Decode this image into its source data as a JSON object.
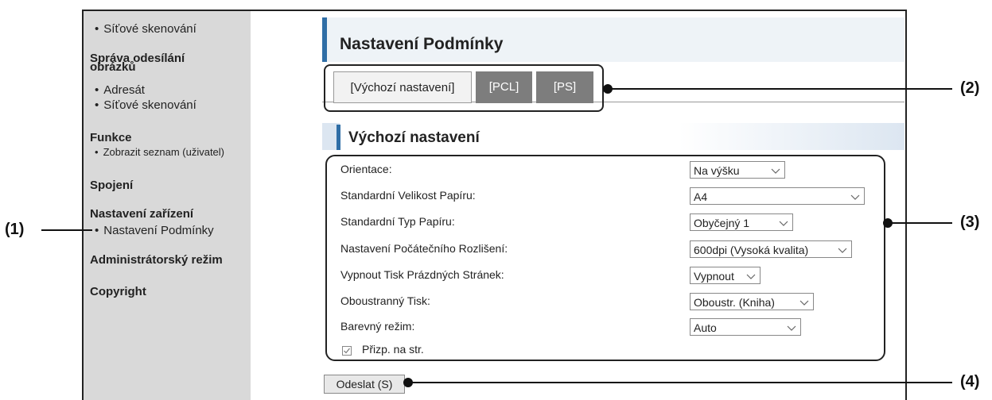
{
  "sidebar": {
    "item_net_scan_1": "Síťové skenování",
    "group_image_send_line1": "Správa odesílání",
    "group_image_send_line2": "obrázků",
    "item_address": "Adresát",
    "item_net_scan_2": "Síťové skenování",
    "group_functions": "Funkce",
    "item_show_list": "Zobrazit seznam (uživatel)",
    "group_connection": "Spojení",
    "group_device_settings": "Nastavení zařízení",
    "item_condition_settings": "Nastavení Podmínky",
    "group_admin": "Administrátorský režim",
    "group_copyright": "Copyright"
  },
  "page": {
    "title": "Nastavení Podmínky"
  },
  "tabs": [
    "[Výchozí nastavení]",
    "[PCL]",
    "[PS]"
  ],
  "section": {
    "title": "Výchozí nastavení"
  },
  "form": {
    "fields": [
      {
        "label": "Orientace:",
        "value": "Na výšku"
      },
      {
        "label": "Standardní Velikost Papíru:",
        "value": "A4"
      },
      {
        "label": "Standardní Typ Papíru:",
        "value": "Obyčejný 1"
      },
      {
        "label": "Nastavení Počátečního Rozlišení:",
        "value": "600dpi (Vysoká kvalita)"
      },
      {
        "label": "Vypnout Tisk Prázdných Stránek:",
        "value": "Vypnout"
      },
      {
        "label": "Oboustranný Tisk:",
        "value": "Oboustr. (Kniha)"
      },
      {
        "label": "Barevný režim:",
        "value": "Auto"
      }
    ],
    "checkbox_label": "Přizp. na str.",
    "checkbox_checked": true,
    "submit_label": "Odeslat (S)"
  },
  "callouts": {
    "c1": "(1)",
    "c2": "(2)",
    "c3": "(3)",
    "c4": "(4)"
  }
}
